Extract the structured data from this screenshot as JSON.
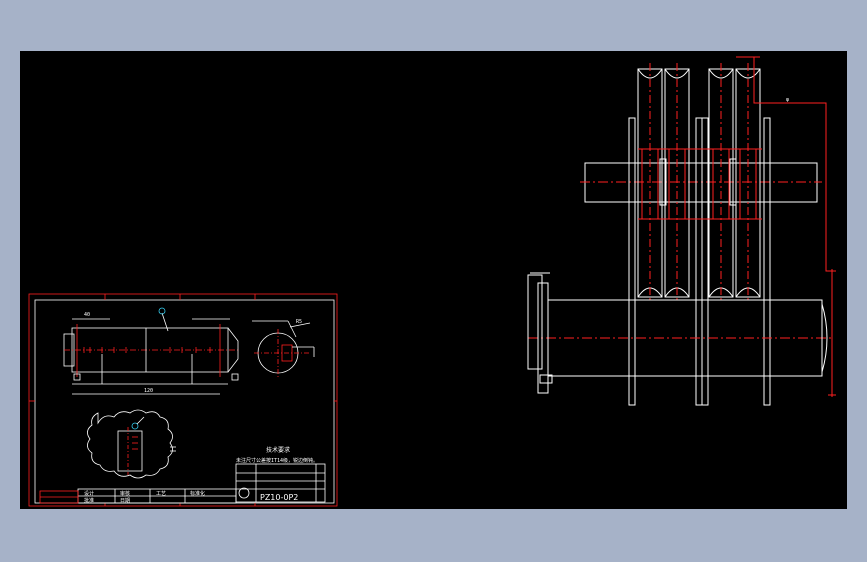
{
  "drawing": {
    "drawing_number": "PZ10-0P2",
    "notes_title": "技术要求",
    "notes_text": "未注尺寸公差按IT14级，锐边倒钝。",
    "block_labels": [
      "设计",
      "审核",
      "工艺",
      "标准化",
      "批准",
      "日期"
    ],
    "dim_labels": [
      "φ",
      "40",
      "120",
      "R5"
    ]
  },
  "colors": {
    "background": "#a6b2c8",
    "canvas": "#000000",
    "outline": "#ffffff",
    "red": "#ff2020",
    "cyan": "#33ccee"
  }
}
